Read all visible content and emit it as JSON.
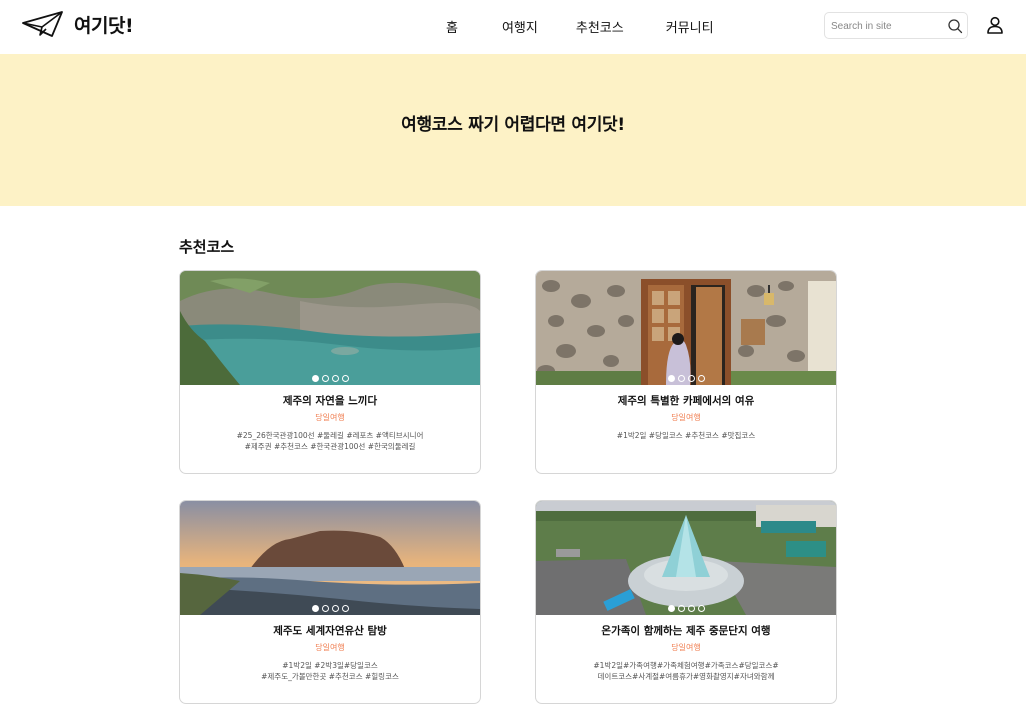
{
  "header": {
    "logo_text": "여기닷!",
    "nav": [
      "홈",
      "여행지",
      "추천코스",
      "커뮤니티"
    ],
    "search_placeholder": "Search in site"
  },
  "hero": {
    "title": "여행코스 짜기 어렵다면 여기닷!"
  },
  "section": {
    "title": "추천코스"
  },
  "cards": [
    {
      "title": "제주의 자연을 느끼다",
      "type": "당일여행",
      "tags_line1": "#25_26한국관광100선 #둘레길 #레포츠 #액티브시니어",
      "tags_line2": "#제주권 #추천코스 #한국관광100선 #한국의둘레길"
    },
    {
      "title": "제주의 특별한 카페에서의 여유",
      "type": "당일여행",
      "tags_line1": "#1박2일 #당일코스 #추천코스 #맛집코스",
      "tags_line2": ""
    },
    {
      "title": "제주도 세계자연유산 탐방",
      "type": "당일여행",
      "tags_line1": "#1박2일 #2박3일#당일코스",
      "tags_line2": "#제주도_가볼만한곳 #추천코스 #힐링코스"
    },
    {
      "title": "온가족이 함께하는 제주 중문단지 여행",
      "type": "당일여행",
      "tags_line1": "#1박2일#가족여행#가족체험여행#가족코스#당일코스#",
      "tags_line2": "데이트코스#사계절#여름휴가#영화촬영지#자녀와함께"
    }
  ]
}
